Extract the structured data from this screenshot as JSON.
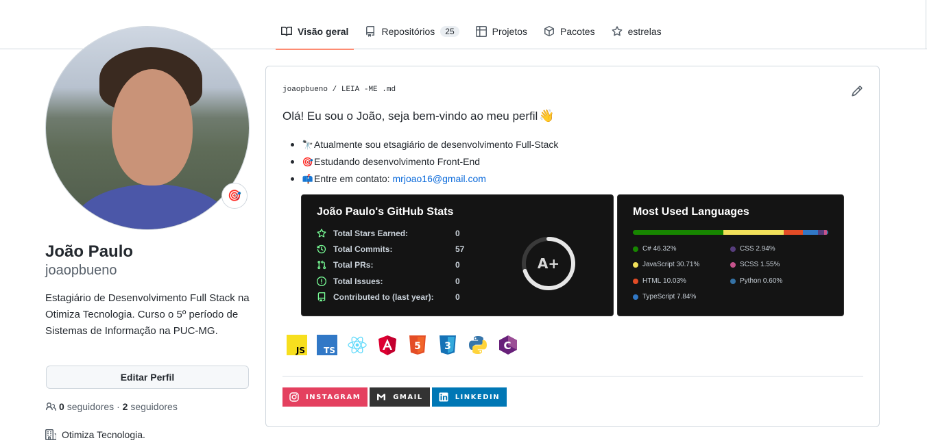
{
  "nav": {
    "tabs": [
      {
        "label": "Visão geral",
        "icon": "book-icon",
        "active": true
      },
      {
        "label": "Repositórios",
        "icon": "repo-icon",
        "counter": "25"
      },
      {
        "label": "Projetos",
        "icon": "table-icon"
      },
      {
        "label": "Pacotes",
        "icon": "package-icon"
      },
      {
        "label": "estrelas",
        "icon": "star-icon"
      }
    ]
  },
  "profile": {
    "name": "João Paulo",
    "username": "joaopbueno",
    "status_emoji": "🎯",
    "bio": "Estagiário de Desenvolvimento Full Stack na Otimiza Tecnologia. Curso o 5º período de Sistemas de Informação na PUC-MG.",
    "edit_label": "Editar Perfil",
    "followers_count": "0",
    "followers_label": "seguidores",
    "following_count": "2",
    "following_label": "seguidores",
    "separator": "·",
    "organization": "Otimiza Tecnologia."
  },
  "readme": {
    "path_user": "joaopbueno",
    "path_sep": "/",
    "path_file": "LEIA -ME .md",
    "title": "Olá! Eu sou o João, seja bem-vindo ao meu perfil",
    "title_emoji": "👋",
    "bullets": [
      {
        "emoji": "🔭",
        "text": "Atualmente sou etsagiário de desenvolvimento Full-Stack"
      },
      {
        "emoji": "🎯",
        "text": "Estudando desenvolvimento Front-End"
      },
      {
        "emoji": "📫",
        "text": "Entre em contato:",
        "link": "mrjoao16@gmail.com"
      }
    ],
    "stats": {
      "title": "João Paulo's GitHub Stats",
      "rows": [
        {
          "label": "Total Stars Earned:",
          "value": "0",
          "icon": "star-icon"
        },
        {
          "label": "Total Commits:",
          "value": "57",
          "icon": "history-icon"
        },
        {
          "label": "Total PRs:",
          "value": "0",
          "icon": "pull-request-icon"
        },
        {
          "label": "Total Issues:",
          "value": "0",
          "icon": "issue-icon"
        },
        {
          "label": "Contributed to (last year):",
          "value": "0",
          "icon": "repo-icon"
        }
      ],
      "grade": "A+",
      "grade_progress_pct": 70
    },
    "languages": {
      "title": "Most Used Languages",
      "items": [
        {
          "name": "C#",
          "pct": "46.32%",
          "value": 46.32,
          "color": "#178600"
        },
        {
          "name": "JavaScript",
          "pct": "30.71%",
          "value": 30.71,
          "color": "#f1e05a"
        },
        {
          "name": "HTML",
          "pct": "10.03%",
          "value": 10.03,
          "color": "#e34c26"
        },
        {
          "name": "TypeScript",
          "pct": "7.84%",
          "value": 7.84,
          "color": "#3178c6"
        },
        {
          "name": "CSS",
          "pct": "2.94%",
          "value": 2.94,
          "color": "#563d7c"
        },
        {
          "name": "SCSS",
          "pct": "1.55%",
          "value": 1.55,
          "color": "#c6538c"
        },
        {
          "name": "Python",
          "pct": "0.60%",
          "value": 0.6,
          "color": "#3572A5"
        }
      ]
    },
    "tech_icons": [
      {
        "name": "javascript-icon",
        "text": "JS"
      },
      {
        "name": "typescript-icon",
        "text": "TS"
      },
      {
        "name": "react-icon"
      },
      {
        "name": "angular-icon"
      },
      {
        "name": "html5-icon",
        "text": "5"
      },
      {
        "name": "css3-icon",
        "text": "3"
      },
      {
        "name": "python-icon"
      },
      {
        "name": "csharp-icon",
        "text": "C"
      }
    ],
    "badges": [
      {
        "label": "INSTAGRAM",
        "icon": "instagram-icon",
        "color": "#e4405f"
      },
      {
        "label": "GMAIL",
        "icon": "gmail-icon",
        "color": "#333333"
      },
      {
        "label": "LINKEDIN",
        "icon": "linkedin-icon",
        "color": "#0077b5"
      }
    ]
  }
}
